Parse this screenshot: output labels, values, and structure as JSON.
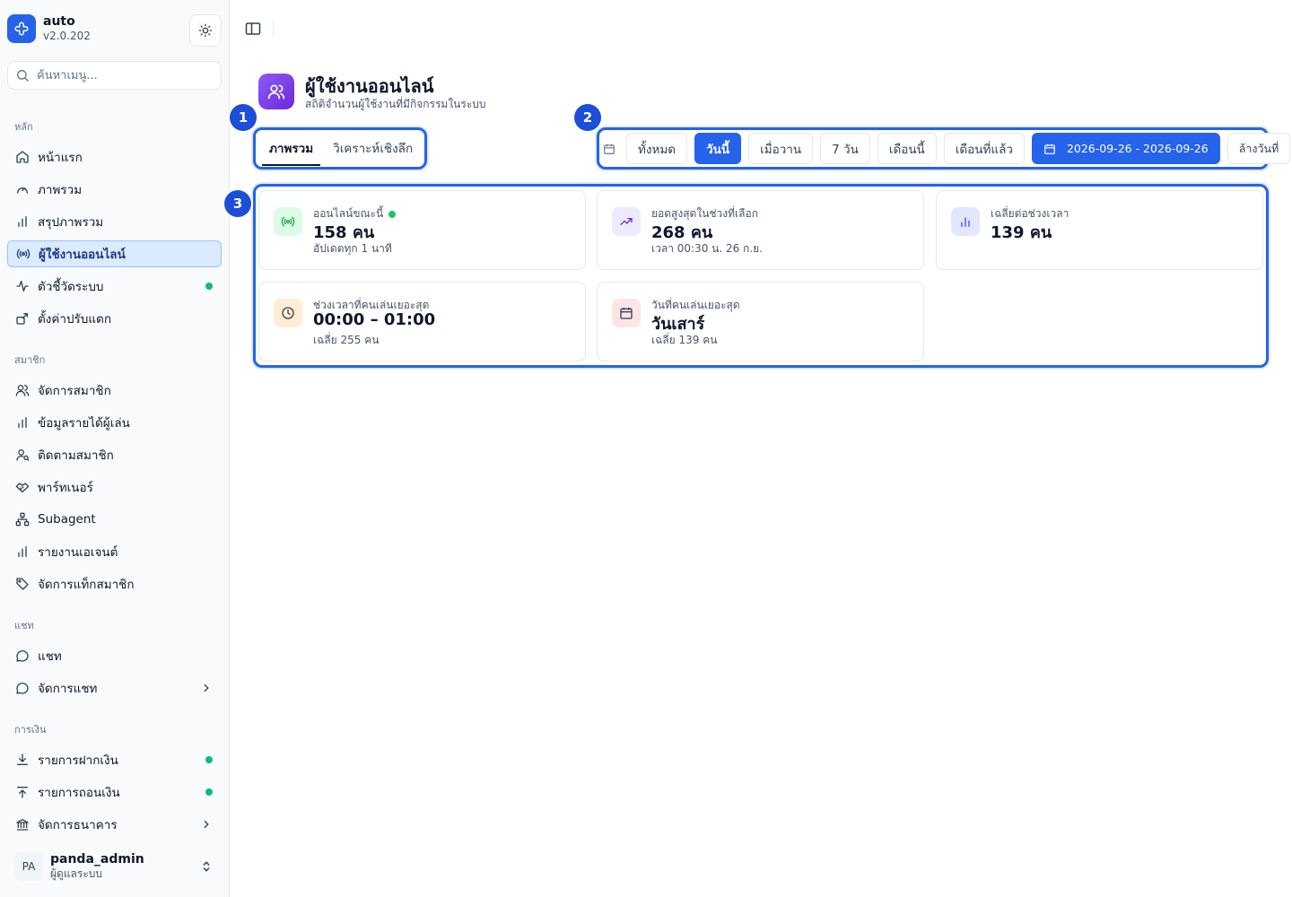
{
  "app": {
    "name": "auto",
    "version": "v2.0.202"
  },
  "search": {
    "placeholder": "ค้นหาเมนู..."
  },
  "sidebar": {
    "groups": [
      {
        "label": "หลัก",
        "items": [
          {
            "label": "หน้าแรก",
            "icon": "home-icon"
          },
          {
            "label": "ภาพรวม",
            "icon": "gauge-icon"
          },
          {
            "label": "สรุปภาพรวม",
            "icon": "bar-chart-icon"
          },
          {
            "label": "ผู้ใช้งานออนไลน์",
            "icon": "radio-icon",
            "active": true
          },
          {
            "label": "ตัวชี้วัดระบบ",
            "icon": "activity-icon",
            "status": "online"
          },
          {
            "label": "ตั้งค่าปรับแตก",
            "icon": "settings-icon"
          }
        ]
      },
      {
        "label": "สมาชิก",
        "items": [
          {
            "label": "จัดการสมาชิก",
            "icon": "users-icon"
          },
          {
            "label": "ข้อมูลรายได้ผู้เล่น",
            "icon": "bar-chart-icon"
          },
          {
            "label": "ติดตามสมาชิก",
            "icon": "user-search-icon"
          },
          {
            "label": "พาร์ทเนอร์",
            "icon": "handshake-icon"
          },
          {
            "label": "Subagent",
            "icon": "network-icon"
          },
          {
            "label": "รายงานเอเจนต์",
            "icon": "bar-chart-icon"
          },
          {
            "label": "จัดการแท็กสมาชิก",
            "icon": "tag-icon"
          }
        ]
      },
      {
        "label": "แชท",
        "items": [
          {
            "label": "แชท",
            "icon": "chat-icon"
          },
          {
            "label": "จัดการแชท",
            "icon": "chat-icon",
            "expandable": true
          }
        ]
      },
      {
        "label": "การเงิน",
        "items": [
          {
            "label": "รายการฝากเงิน",
            "icon": "download-icon",
            "status": "online"
          },
          {
            "label": "รายการถอนเงิน",
            "icon": "upload-icon",
            "status": "online"
          },
          {
            "label": "จัดการธนาคาร",
            "icon": "bank-icon",
            "expandable": true
          }
        ]
      }
    ]
  },
  "user": {
    "initials": "PA",
    "name": "panda_admin",
    "role": "ผู้ดูแลระบบ"
  },
  "page": {
    "title": "ผู้ใช้งานออนไลน์",
    "subtitle": "สถิติจำนวนผู้ใช้งานที่มีกิจกรรมในระบบ"
  },
  "callouts": [
    "1",
    "2",
    "3"
  ],
  "tabs": [
    {
      "label": "ภาพรวม",
      "active": true
    },
    {
      "label": "วิเคราะห์เชิงลึก",
      "active": false
    }
  ],
  "filters": {
    "presets": [
      {
        "label": "ทั้งหมด",
        "active": false
      },
      {
        "label": "วันนี้",
        "active": true
      },
      {
        "label": "เมื่อวาน",
        "active": false
      },
      {
        "label": "7 วัน",
        "active": false
      },
      {
        "label": "เดือนนี้",
        "active": false
      },
      {
        "label": "เดือนที่แล้ว",
        "active": false
      }
    ],
    "range": "2026-09-26 - 2026-09-26",
    "clear": "ล้างวันที่"
  },
  "stats": [
    {
      "label": "ออนไลน์ขณะนี้",
      "value": "158 คน",
      "note": "อัปเดตทุก 1 นาที",
      "icon": "radio-icon",
      "live": true
    },
    {
      "label": "ยอดสูงสุดในช่วงที่เลือก",
      "value": "268 คน",
      "note": "เวลา 00:30 น. 26 ก.ย.",
      "icon": "trending-up-icon"
    },
    {
      "label": "เฉลี่ยต่อช่วงเวลา",
      "value": "139 คน",
      "note": "",
      "icon": "bar-chart-icon"
    },
    {
      "label": "ช่วงเวลาที่คนเล่นเยอะสุด",
      "value": "00:00 – 01:00",
      "note": "เฉลี่ย 255 คน",
      "icon": "clock-icon"
    },
    {
      "label": "วันที่คนเล่นเยอะสุด",
      "value": "วันเสาร์",
      "note": "เฉลี่ย 139 คน",
      "icon": "calendar-icon"
    }
  ],
  "colors": {
    "accent": "#2563eb",
    "online": "#10b981",
    "purple": "#7c3aed"
  }
}
